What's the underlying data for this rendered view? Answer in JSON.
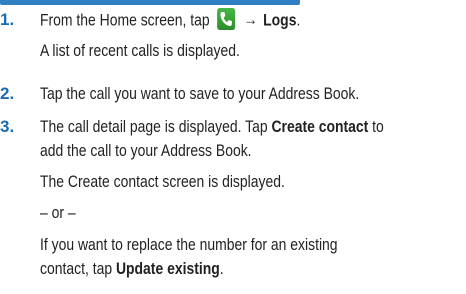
{
  "steps": [
    {
      "number": "1.",
      "lines": [
        {
          "pre": "From the Home screen, tap",
          "arrow": "→",
          "post": "Logs",
          "tail": "."
        },
        {
          "text": "A list of recent calls is displayed."
        }
      ]
    },
    {
      "number": "2.",
      "lines": [
        {
          "text": "Tap the call you want to save to your Address Book."
        }
      ]
    },
    {
      "number": "3.",
      "lines": [
        {
          "pre": "The call detail page is displayed. Tap ",
          "bold": "Create contact",
          "post": " to"
        },
        {
          "text": "add the call to your Address Book."
        },
        {
          "text": "The Create contact screen is displayed."
        },
        {
          "text": "– or –"
        },
        {
          "text": "If you want to replace the number for an existing"
        },
        {
          "pre": "contact, tap ",
          "bold": "Update existing",
          "post": "."
        }
      ]
    }
  ],
  "icons": {
    "phone": "phone-icon"
  },
  "colors": {
    "step_number": "#1a6db3",
    "header_bar": "#2f7fc2",
    "phone_icon": "#3aa63a"
  }
}
